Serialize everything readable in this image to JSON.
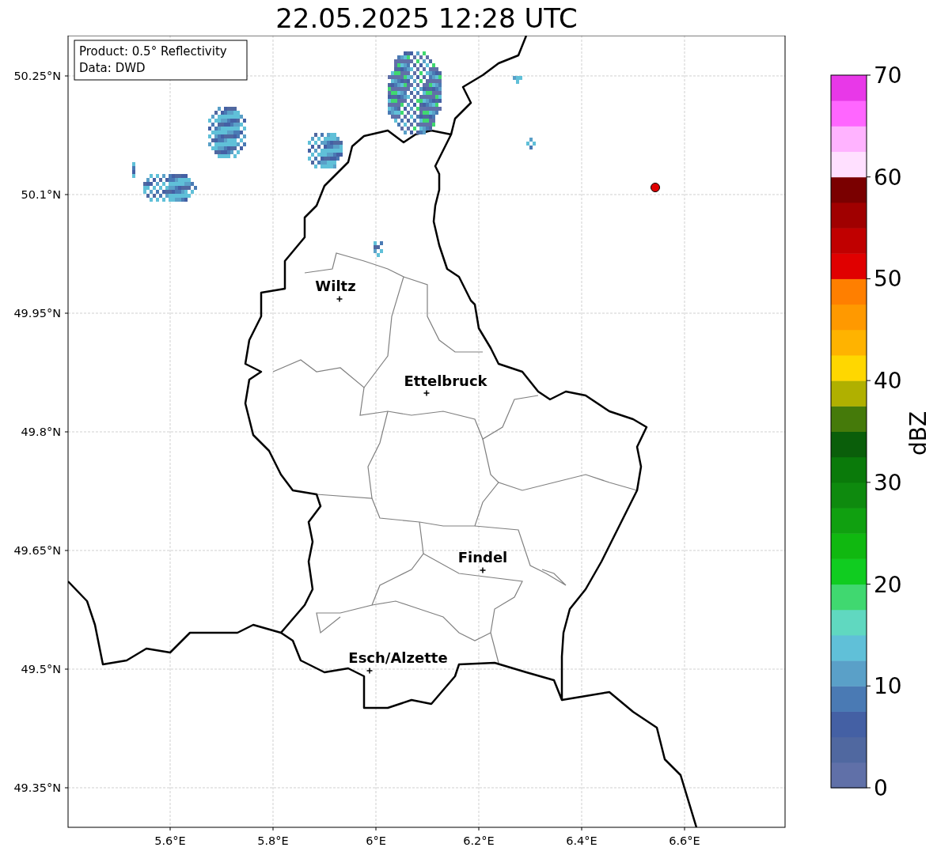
{
  "title": "22.05.2025 12:28 UTC",
  "info_box": {
    "lines": [
      "Product: 0.5° Reflectivity",
      "Data: DWD"
    ]
  },
  "map": {
    "lat_labels": [
      "50.25°N",
      "50.1°N",
      "49.95°N",
      "49.8°N",
      "49.65°N",
      "49.5°N",
      "49.35°N"
    ],
    "lon_labels": [
      "5.6°E",
      "5.8°E",
      "6°E",
      "6.2°E",
      "6.4°E",
      "6.6°E"
    ],
    "cities": [
      {
        "name": "Wiltz"
      },
      {
        "name": "Ettelbruck"
      },
      {
        "name": "Findel"
      },
      {
        "name": "Esch/Alzette"
      }
    ]
  },
  "colorbar": {
    "label": "dBZ",
    "ticks": [
      "70",
      "60",
      "50",
      "40",
      "30",
      "20",
      "10",
      "0"
    ],
    "bins": [
      {
        "color": "#6070a8"
      },
      {
        "color": "#5068a0"
      },
      {
        "color": "#4460a4"
      },
      {
        "color": "#4a7ab4"
      },
      {
        "color": "#5aa0c8"
      },
      {
        "color": "#60c0d8"
      },
      {
        "color": "#60d8c0"
      },
      {
        "color": "#40d870"
      },
      {
        "color": "#10cc20"
      },
      {
        "color": "#10b810"
      },
      {
        "color": "#10a010"
      },
      {
        "color": "#0e8a0e"
      },
      {
        "color": "#0a7a0a"
      },
      {
        "color": "#0a5e0a"
      },
      {
        "color": "#457a0a"
      },
      {
        "color": "#b0b000"
      },
      {
        "color": "#ffd700"
      },
      {
        "color": "#ffb300"
      },
      {
        "color": "#ff9900"
      },
      {
        "color": "#ff7f00"
      },
      {
        "color": "#e00000"
      },
      {
        "color": "#c00000"
      },
      {
        "color": "#a00000"
      },
      {
        "color": "#7a0000"
      },
      {
        "color": "#ffe0ff"
      },
      {
        "color": "#ffb3ff"
      },
      {
        "color": "#ff66ff"
      },
      {
        "color": "#e838e8"
      }
    ]
  }
}
